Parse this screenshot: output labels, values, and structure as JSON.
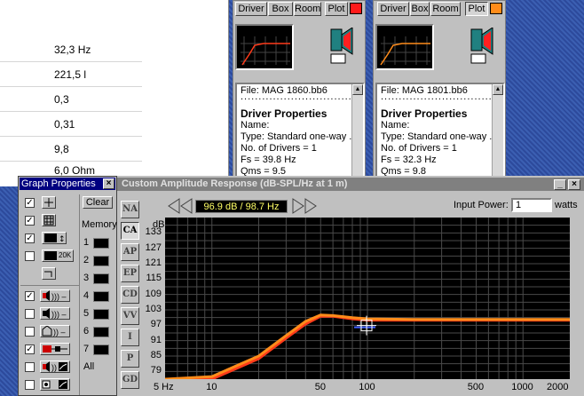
{
  "background_table": {
    "rows": [
      "32,3 Hz",
      "221,5 l",
      "0,3",
      "0,31",
      "9,8",
      "6,0 Ohm"
    ]
  },
  "driver_panels": [
    {
      "tabs": [
        "Driver",
        "Box",
        "Room",
        "Plot"
      ],
      "swatch_color": "#ff1a1a",
      "file": "File: MAG 1860.bb6",
      "heading": "Driver Properties",
      "lines": [
        "Name:",
        "Type: Standard one-way ...",
        "No. of Drivers = 1",
        "Fs =  39.8 Hz",
        "Qms =  9.5"
      ]
    },
    {
      "tabs": [
        "Driver",
        "Box",
        "Room",
        "Plot"
      ],
      "swatch_color": "#ff8c1a",
      "file": "File: MAG 1801.bb6",
      "heading": "Driver Properties",
      "lines": [
        "Name:",
        "Type: Standard one-way ...",
        "No. of Drivers = 1",
        "Fs =  32.3 Hz",
        "Qms =  9.8"
      ]
    }
  ],
  "graph_properties": {
    "title": "Graph Properties",
    "clear_label": "Clear",
    "memory_label": "Memory",
    "memory_slots": [
      "1",
      "2",
      "3",
      "4",
      "5",
      "6",
      "7"
    ],
    "all_label": "All",
    "grid_20k_label": "20K",
    "checks_top": [
      true,
      true,
      true,
      false
    ],
    "checks_bottom": [
      true,
      false,
      false,
      true,
      false,
      false
    ]
  },
  "car_window": {
    "title": "Custom Amplitude Response (dB-SPL/Hz at 1 m)",
    "side_buttons": [
      "NA",
      "CA",
      "AP",
      "EP",
      "CD",
      "VV",
      "I",
      "P",
      "GD"
    ],
    "active_side": "CA",
    "readout": "96.9 dB / 98.7 Hz",
    "input_power_label": "Input Power:",
    "input_power_value": "1",
    "input_power_unit": "watts"
  },
  "chart_data": {
    "type": "line",
    "ylabel": "dB",
    "y_ticks": [
      "133",
      "127",
      "121",
      "115",
      "109",
      "103",
      "97",
      "91",
      "85",
      "79"
    ],
    "x_ticks": [
      "5 Hz",
      "10",
      "50",
      "100",
      "500",
      "1000",
      "2000"
    ],
    "x_scale": "log",
    "xlim": [
      5,
      2000
    ],
    "ylim": [
      76,
      139
    ],
    "grid": true,
    "series": [
      {
        "color": "#ff3b1a",
        "x": [
          5,
          10,
          20,
          30,
          40,
          50,
          60,
          80,
          100,
          200,
          500,
          1000,
          2000
        ],
        "y": [
          76,
          76,
          84,
          92,
          97.5,
          100.5,
          100.5,
          99.5,
          99,
          99,
          99,
          99,
          99
        ]
      },
      {
        "color": "#ff8c1a",
        "x": [
          5,
          10,
          20,
          30,
          40,
          50,
          60,
          80,
          100,
          200,
          500,
          1000,
          2000
        ],
        "y": [
          76,
          77,
          85,
          93,
          98.5,
          101,
          100.8,
          100,
          99.5,
          99.3,
          99.3,
          99.3,
          99.3
        ]
      }
    ],
    "cursor": {
      "x": 98.7,
      "y": 96.9
    }
  }
}
